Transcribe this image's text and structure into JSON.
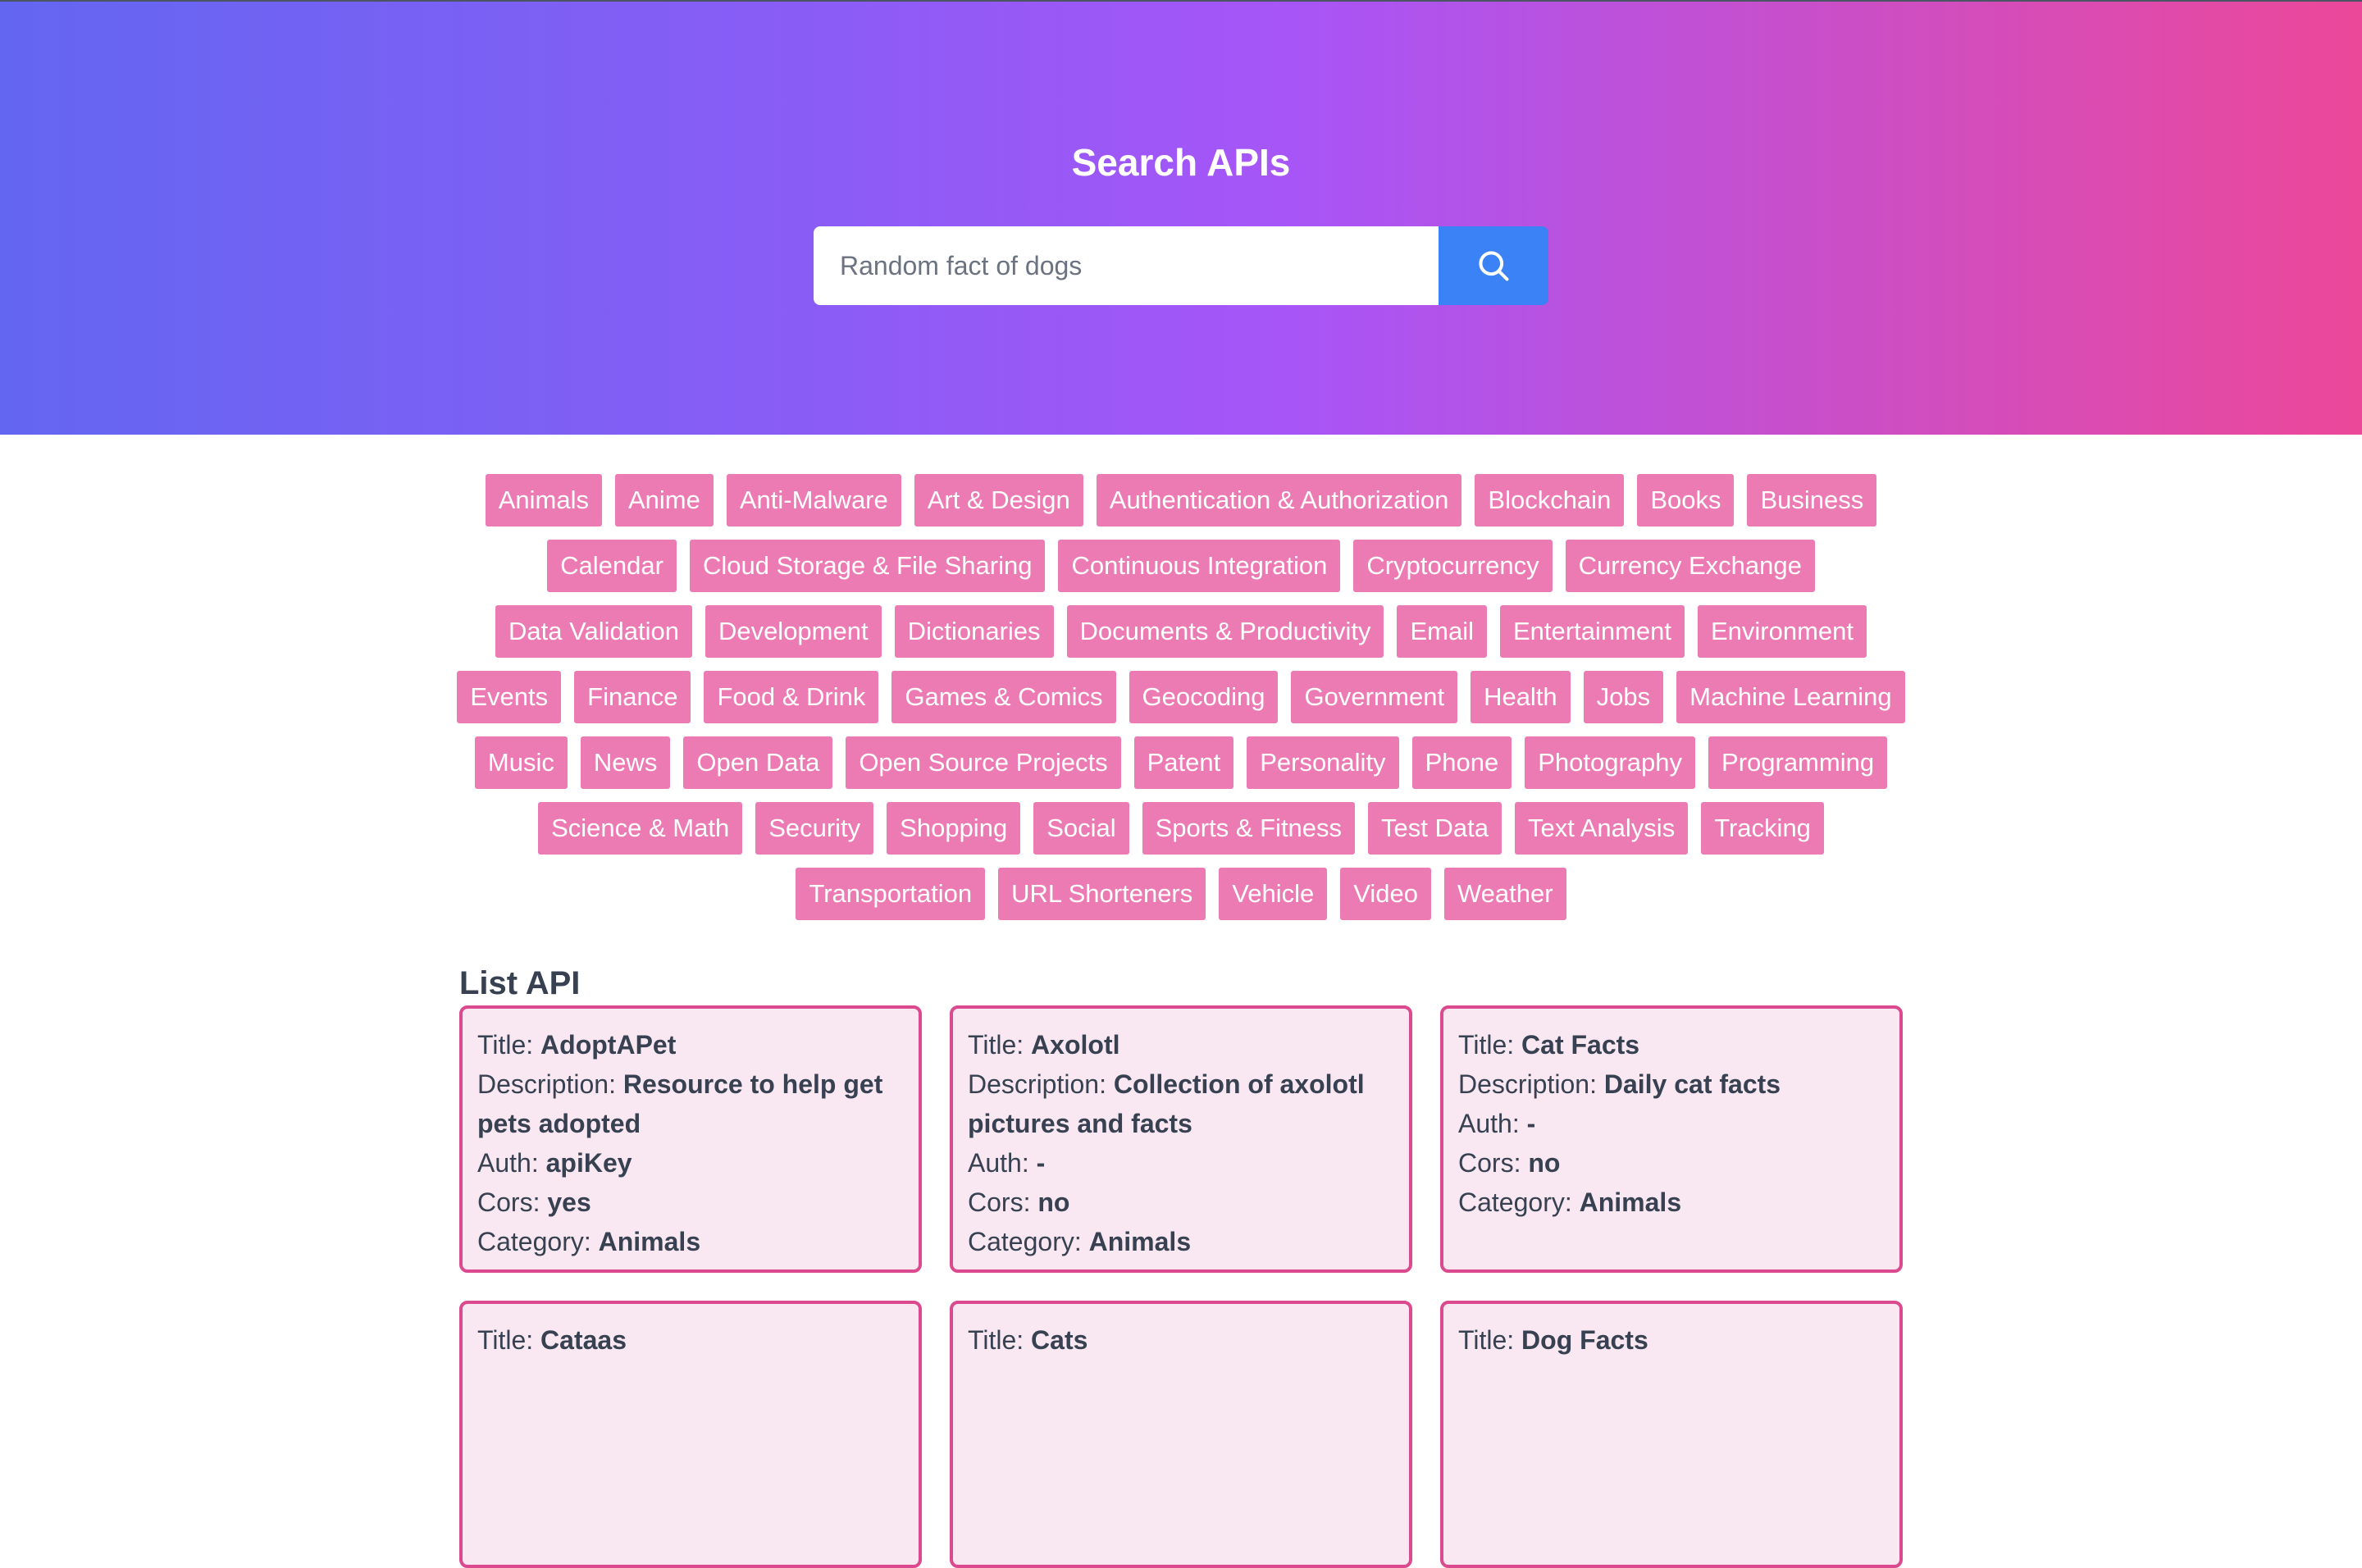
{
  "hero": {
    "title": "Search APIs",
    "search_placeholder": "Random fact of dogs"
  },
  "tags": [
    "Animals",
    "Anime",
    "Anti-Malware",
    "Art & Design",
    "Authentication & Authorization",
    "Blockchain",
    "Books",
    "Business",
    "Calendar",
    "Cloud Storage & File Sharing",
    "Continuous Integration",
    "Cryptocurrency",
    "Currency Exchange",
    "Data Validation",
    "Development",
    "Dictionaries",
    "Documents & Productivity",
    "Email",
    "Entertainment",
    "Environment",
    "Events",
    "Finance",
    "Food & Drink",
    "Games & Comics",
    "Geocoding",
    "Government",
    "Health",
    "Jobs",
    "Machine Learning",
    "Music",
    "News",
    "Open Data",
    "Open Source Projects",
    "Patent",
    "Personality",
    "Phone",
    "Photography",
    "Programming",
    "Science & Math",
    "Security",
    "Shopping",
    "Social",
    "Sports & Fitness",
    "Test Data",
    "Text Analysis",
    "Tracking",
    "Transportation",
    "URL Shorteners",
    "Vehicle",
    "Video",
    "Weather"
  ],
  "list": {
    "title": "List API",
    "field_labels": {
      "title": "Title: ",
      "description": "Description: ",
      "auth": "Auth: ",
      "cors": "Cors: ",
      "category": "Category: "
    },
    "items": [
      {
        "title": "AdoptAPet",
        "description": "Resource to help get pets adopted",
        "auth": "apiKey",
        "cors": "yes",
        "category": "Animals"
      },
      {
        "title": "Axolotl",
        "description": "Collection of axolotl pictures and facts",
        "auth": "-",
        "cors": "no",
        "category": "Animals"
      },
      {
        "title": "Cat Facts",
        "description": "Daily cat facts",
        "auth": "-",
        "cors": "no",
        "category": "Animals"
      },
      {
        "title": "Cataas"
      },
      {
        "title": "Cats"
      },
      {
        "title": "Dog Facts"
      }
    ]
  },
  "colors": {
    "gradient_start": "#6366f1",
    "gradient_end": "#ec4899",
    "tag_bg": "#ec7bb4",
    "search_button": "#3b82f6",
    "card_border": "#db4a8f",
    "card_bg": "#f9e8f1"
  },
  "icons": {
    "search_button": "search-icon"
  }
}
